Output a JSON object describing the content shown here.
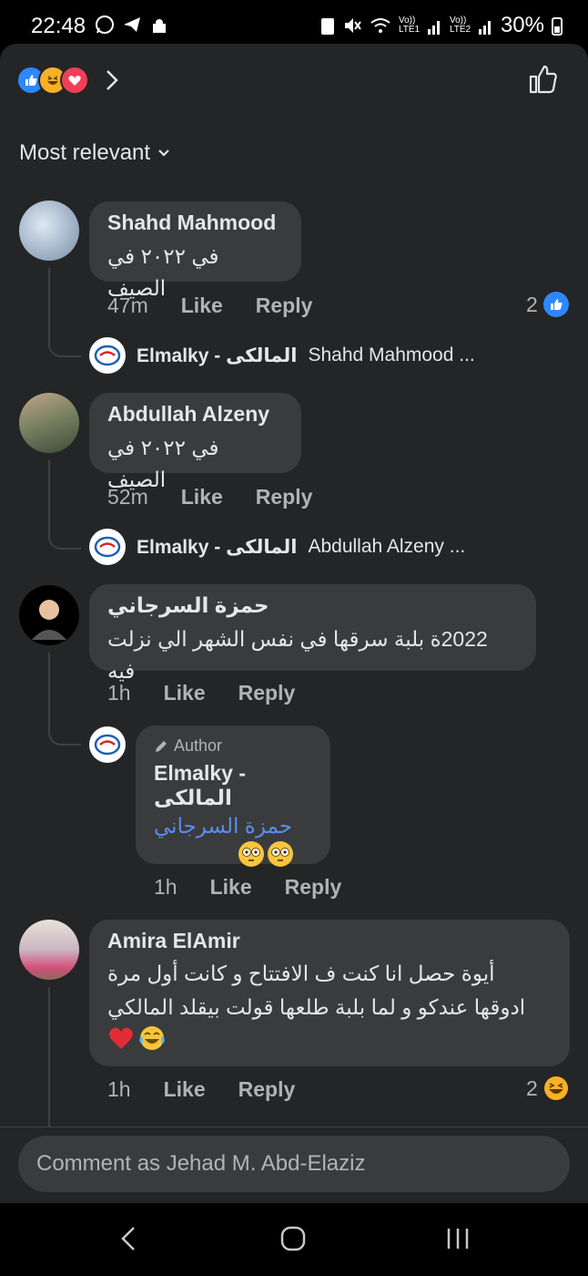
{
  "status_bar": {
    "time": "22:48",
    "net1": "Vo)) LTE1",
    "net2": "Vo)) LTE2",
    "battery": "30%"
  },
  "header": {
    "reaction_icons": [
      "like",
      "haha",
      "love"
    ]
  },
  "sort_label": "Most relevant",
  "comments": [
    {
      "name": "Shahd Mahmood",
      "text": "في ٢٠٢٢  في الصيف",
      "time": "47m",
      "like": "Like",
      "reply": "Reply",
      "reaction_count": "2",
      "reply_preview": {
        "name": "Elmalky - المالكى",
        "text": "Shahd Mahmood ..."
      }
    },
    {
      "name": "Abdullah Alzeny",
      "text": "في ٢٠٢٢  في الصيف",
      "time": "52m",
      "like": "Like",
      "reply": "Reply",
      "reply_preview": {
        "name": "Elmalky - المالكى",
        "text": "Abdullah Alzeny ..."
      }
    },
    {
      "name": "حمزة السرجاني",
      "text": "2022ة بلبة سرقها في نفس الشهر الي نزلت فيه",
      "time": "1h",
      "like": "Like",
      "reply": "Reply"
    },
    {
      "name": "Amira ElAmir",
      "text_line1": "أيوة حصل انا كنت ف الافتتاح و كانت أول مرة",
      "text_line2": "ادوقها عندكو و لما بلبة طلعها قولت بيقلد المالكي",
      "time": "1h",
      "like": "Like",
      "reply": "Reply",
      "reaction_count": "2"
    }
  ],
  "author_reply": {
    "badge": "Author",
    "name": "Elmalky - المالكى",
    "mention": "حمزة السرجاني",
    "time": "1h",
    "like": "Like",
    "reply": "Reply"
  },
  "comment_input": {
    "placeholder": "Comment as Jehad M. Abd-Elaziz"
  },
  "colors": {
    "background": "#242526",
    "bubble": "#3a3b3c",
    "accent": "#2d88ff",
    "mention": "#5b8def"
  }
}
